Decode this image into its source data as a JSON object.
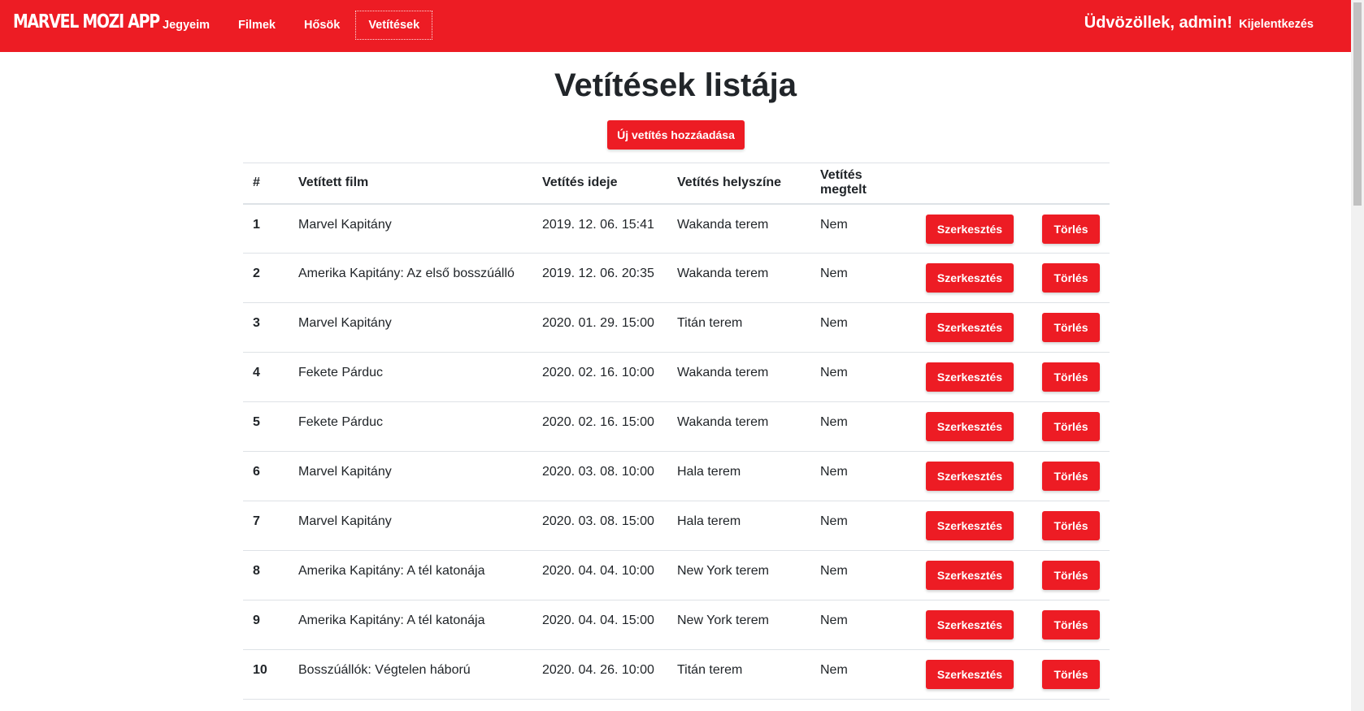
{
  "navbar": {
    "brand": "MARVEL MOZI APP",
    "links": [
      {
        "label": "Jegyeim",
        "active": false
      },
      {
        "label": "Filmek",
        "active": false
      },
      {
        "label": "Hősök",
        "active": false
      },
      {
        "label": "Vetítések",
        "active": true
      }
    ],
    "greeting": "Üdvözöllek, admin!",
    "logout": "Kijelentkezés",
    "color": "#ed1c24"
  },
  "page": {
    "title": "Vetítések listája",
    "add_button": "Új vetítés hozzáadása"
  },
  "table": {
    "headers": [
      "#",
      "Vetített film",
      "Vetítés ideje",
      "Vetítés helyszíne",
      "Vetítés megtelt"
    ],
    "edit_label": "Szerkesztés",
    "delete_label": "Törlés",
    "rows": [
      {
        "id": "1",
        "film": "Marvel Kapitány",
        "time": "2019. 12. 06. 15:41",
        "location": "Wakanda terem",
        "full": "Nem"
      },
      {
        "id": "2",
        "film": "Amerika Kapitány: Az első bosszúálló",
        "time": "2019. 12. 06. 20:35",
        "location": "Wakanda terem",
        "full": "Nem"
      },
      {
        "id": "3",
        "film": "Marvel Kapitány",
        "time": "2020. 01. 29. 15:00",
        "location": "Titán terem",
        "full": "Nem"
      },
      {
        "id": "4",
        "film": "Fekete Párduc",
        "time": "2020. 02. 16. 10:00",
        "location": "Wakanda terem",
        "full": "Nem"
      },
      {
        "id": "5",
        "film": "Fekete Párduc",
        "time": "2020. 02. 16. 15:00",
        "location": "Wakanda terem",
        "full": "Nem"
      },
      {
        "id": "6",
        "film": "Marvel Kapitány",
        "time": "2020. 03. 08. 10:00",
        "location": "Hala terem",
        "full": "Nem"
      },
      {
        "id": "7",
        "film": "Marvel Kapitány",
        "time": "2020. 03. 08. 15:00",
        "location": "Hala terem",
        "full": "Nem"
      },
      {
        "id": "8",
        "film": "Amerika Kapitány: A tél katonája",
        "time": "2020. 04. 04. 10:00",
        "location": "New York terem",
        "full": "Nem"
      },
      {
        "id": "9",
        "film": "Amerika Kapitány: A tél katonája",
        "time": "2020. 04. 04. 15:00",
        "location": "New York terem",
        "full": "Nem"
      },
      {
        "id": "10",
        "film": "Bosszúállók: Végtelen háború",
        "time": "2020. 04. 26. 10:00",
        "location": "Titán terem",
        "full": "Nem"
      }
    ]
  }
}
